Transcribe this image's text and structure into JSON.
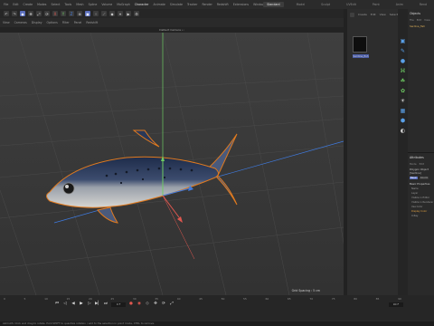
{
  "menu": {
    "items": [
      "File",
      "Edit",
      "Create",
      "Modes",
      "Select",
      "Tools",
      "Mesh",
      "Spline",
      "Volume",
      "MoGraph",
      "Character",
      "Animate",
      "Simulate",
      "Tracker",
      "Render",
      "Redshift",
      "Extensions",
      "Window",
      "Help"
    ],
    "layouts": [
      "Standard",
      "Model",
      "Sculpt",
      "UVEdit",
      "Paint",
      "Anim",
      "Rend"
    ]
  },
  "viewport": {
    "menu_items": [
      "View",
      "Cameras",
      "Display",
      "Options",
      "Filter",
      "Panel",
      "Redshift"
    ],
    "camera_title": "Default Camera •:",
    "status": "Grid Spacing : 5 cm"
  },
  "timeline": {
    "ticks": [
      "0",
      "5",
      "10",
      "15",
      "20",
      "25",
      "30",
      "35",
      "40",
      "45",
      "50",
      "55",
      "60",
      "65",
      "70",
      "75",
      "80",
      "85",
      "90"
    ],
    "frame": "0 F",
    "end_frame": "90 F",
    "status_message": "Azimuth: Click and drag to rotate. Hold SHIFT to quantize rotation / add to the selection in point mode, CTRL to remove."
  },
  "side_panel": {
    "tabs": [
      "Create",
      "Edit",
      "View",
      "Select",
      "Material",
      "Texture"
    ],
    "material_name": "Sardine_fish"
  },
  "objects": {
    "title": "Objects",
    "sub": [
      "File",
      "Edit",
      "View",
      "Object"
    ],
    "object_name": "Sardine_fish"
  },
  "attributes": {
    "title": "Attributes",
    "sub": [
      "Mode",
      "Edit",
      "User Data"
    ],
    "object_label": "Polygon Object [Sardine]",
    "tabs": [
      "Basic",
      "Coord.",
      "Phong"
    ],
    "section": "Basic Properties",
    "props": [
      "Name",
      "Layer",
      "Visible in Editor",
      "Visible in Renderer",
      "Use Color",
      "Display Color",
      "X-Ray"
    ],
    "warn_props": [
      "Display Color"
    ]
  },
  "colors": {
    "accent": "#5b6fbd",
    "selection_outline": "#e07a1f",
    "axis_x": "#e0574f",
    "axis_y": "#6ecb63",
    "axis_z": "#3f7be0"
  }
}
